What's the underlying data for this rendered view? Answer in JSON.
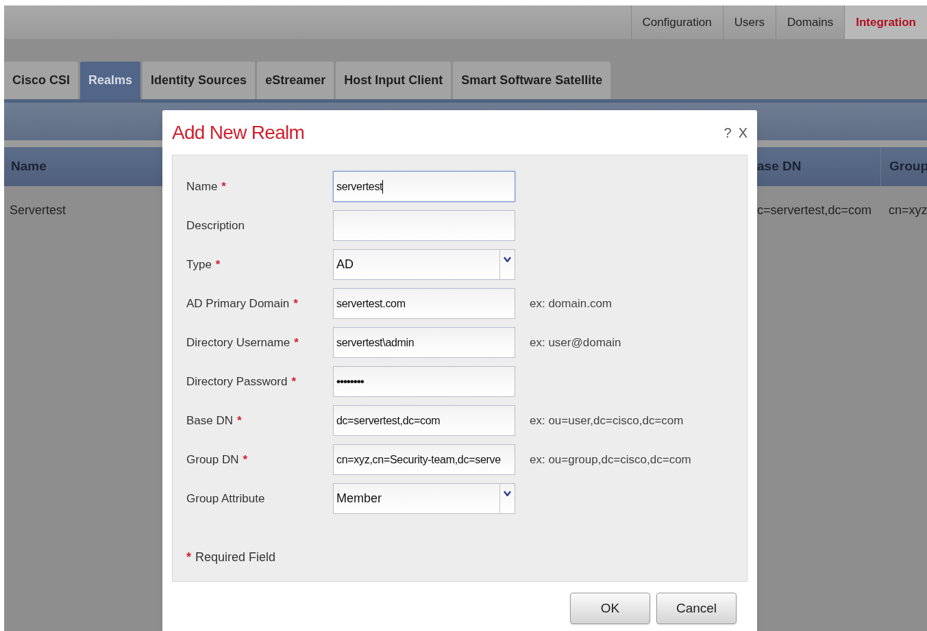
{
  "top_tabs": [
    {
      "label": "Configuration",
      "selected": false
    },
    {
      "label": "Users",
      "selected": false
    },
    {
      "label": "Domains",
      "selected": false
    },
    {
      "label": "Integration",
      "selected": true
    }
  ],
  "sub_tabs": [
    {
      "label": "Cisco CSI",
      "selected": false
    },
    {
      "label": "Realms",
      "selected": true
    },
    {
      "label": "Identity Sources",
      "selected": false
    },
    {
      "label": "eStreamer",
      "selected": false
    },
    {
      "label": "Host Input Client",
      "selected": false
    },
    {
      "label": "Smart Software Satellite",
      "selected": false
    }
  ],
  "table": {
    "columns": [
      "Name",
      "ase DN",
      "Group"
    ],
    "rows": [
      [
        "Servertest",
        "c=servertest,dc=com",
        "cn=xyz"
      ]
    ]
  },
  "dialog": {
    "title": "Add New Realm",
    "help": "?",
    "close": "X",
    "fields": [
      {
        "label": "Name",
        "marker": "*",
        "kind": "text",
        "value": "servertest",
        "focused": true
      },
      {
        "label": "Description",
        "kind": "text",
        "focused": false
      },
      {
        "label": "Type",
        "marker": "*",
        "kind": "select",
        "value": "AD",
        "focused": false
      },
      {
        "label": "AD Primary Domain",
        "marker": "*",
        "kind": "text",
        "value": "servertest.com",
        "hint": "ex: domain.com",
        "focused": false
      },
      {
        "label": "Directory Username",
        "marker": "*",
        "kind": "text",
        "value": "servertest\\admin",
        "hint": "ex: user@domain",
        "focused": false
      },
      {
        "label": "Directory Password",
        "marker": "*",
        "kind": "password",
        "value": "••••••••",
        "focused": false
      },
      {
        "label": "Base DN",
        "marker": "*",
        "kind": "text",
        "value": "dc=servertest,dc=com",
        "hint": "ex: ou=user,dc=cisco,dc=com",
        "focused": false
      },
      {
        "label": "Group DN",
        "marker": "*",
        "kind": "text",
        "value": "cn=xyz,cn=Security-team,dc=serve",
        "hint": "ex: ou=group,dc=cisco,dc=com",
        "focused": false
      },
      {
        "label": "Group Attribute",
        "kind": "select",
        "value": "Member",
        "focused": false
      }
    ],
    "required_note": {
      "marker": "*",
      "text": "Required Field"
    },
    "buttons": [
      "OK",
      "Cancel"
    ]
  }
}
